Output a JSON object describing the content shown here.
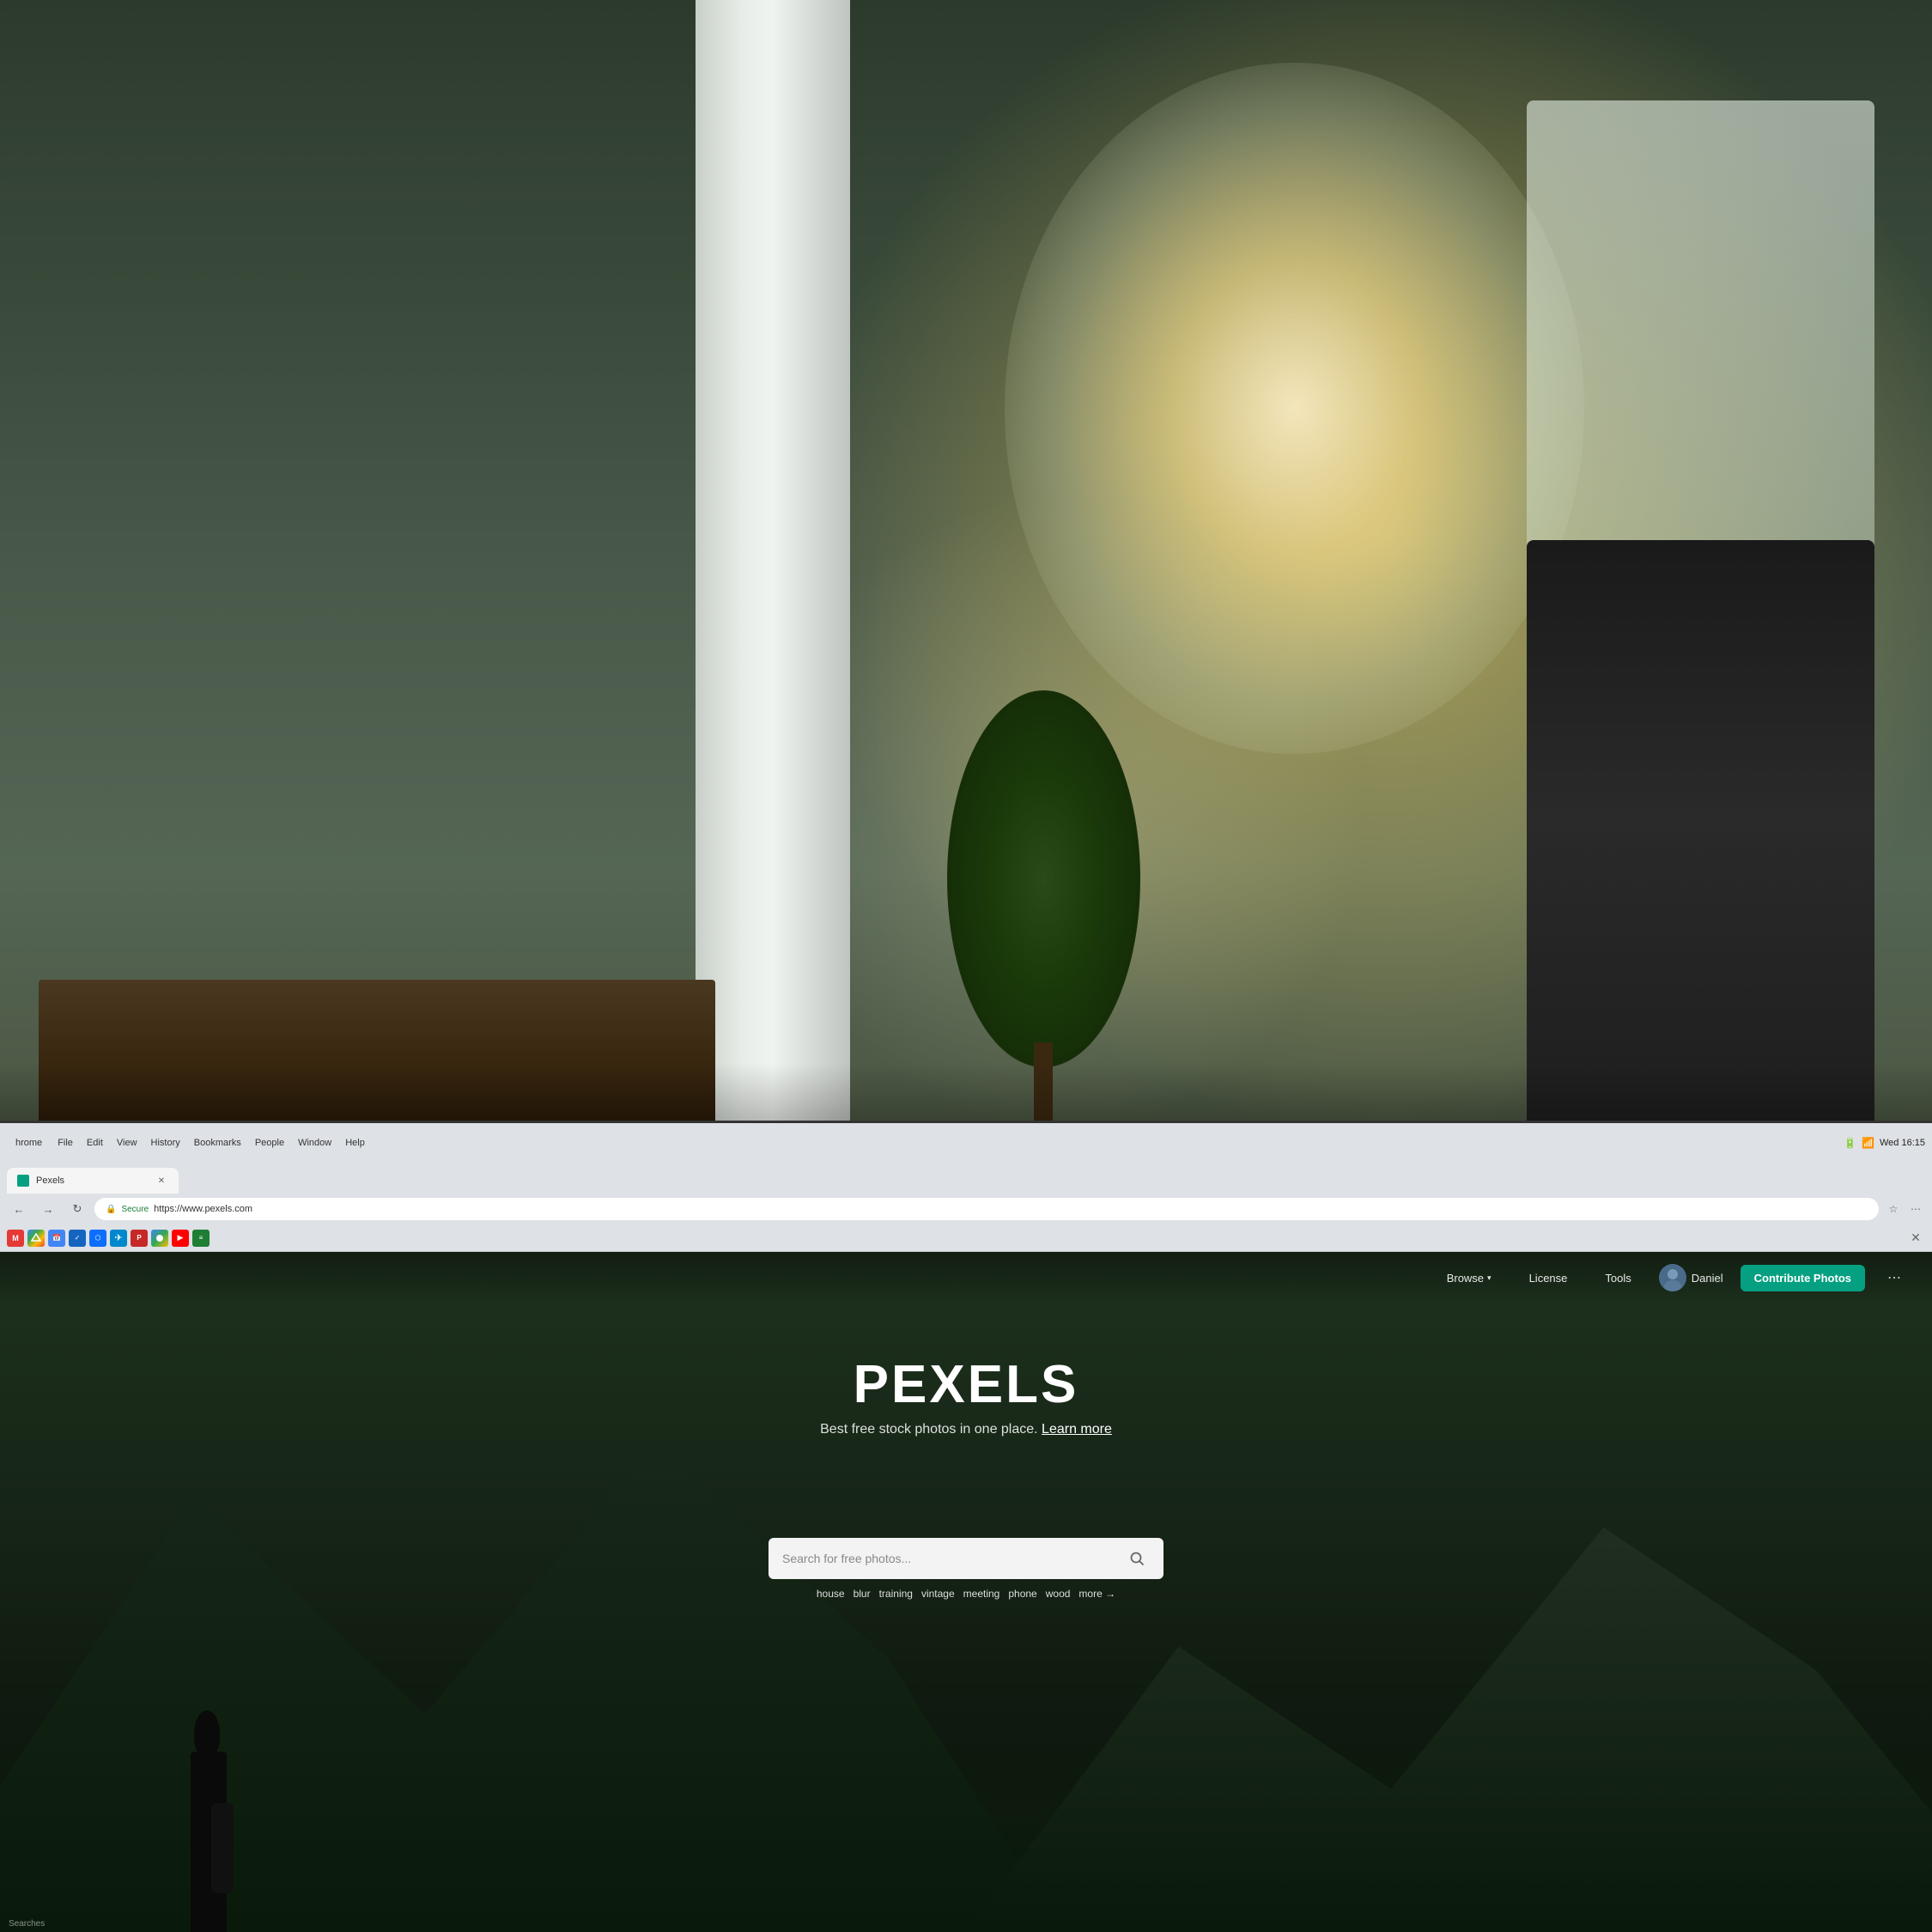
{
  "background": {
    "description": "office interior with bokeh background"
  },
  "os_menu_bar": {
    "app_name": "hrome",
    "menu_items": [
      "File",
      "Edit",
      "View",
      "History",
      "Bookmarks",
      "People",
      "Window",
      "Help"
    ],
    "system": {
      "time": "Wed 16:15",
      "battery": "100 %",
      "wifi": "wifi"
    }
  },
  "browser": {
    "tab": {
      "title": "Pexels",
      "favicon_color": "#05a081"
    },
    "address_bar": {
      "secure_text": "Secure",
      "url": "https://www.pexels.com"
    }
  },
  "pexels": {
    "nav": {
      "browse_label": "Browse",
      "license_label": "License",
      "tools_label": "Tools",
      "user_name": "Daniel",
      "contribute_label": "Contribute Photos",
      "more_icon": "•••"
    },
    "hero": {
      "logo": "PEXELS",
      "subtitle": "Best free stock photos in one place.",
      "learn_more": "Learn more",
      "search_placeholder": "Search for free photos...",
      "tags": [
        "house",
        "blur",
        "training",
        "vintage",
        "meeting",
        "phone",
        "wood"
      ],
      "more_label": "more →"
    },
    "footer_label": "Searches"
  }
}
